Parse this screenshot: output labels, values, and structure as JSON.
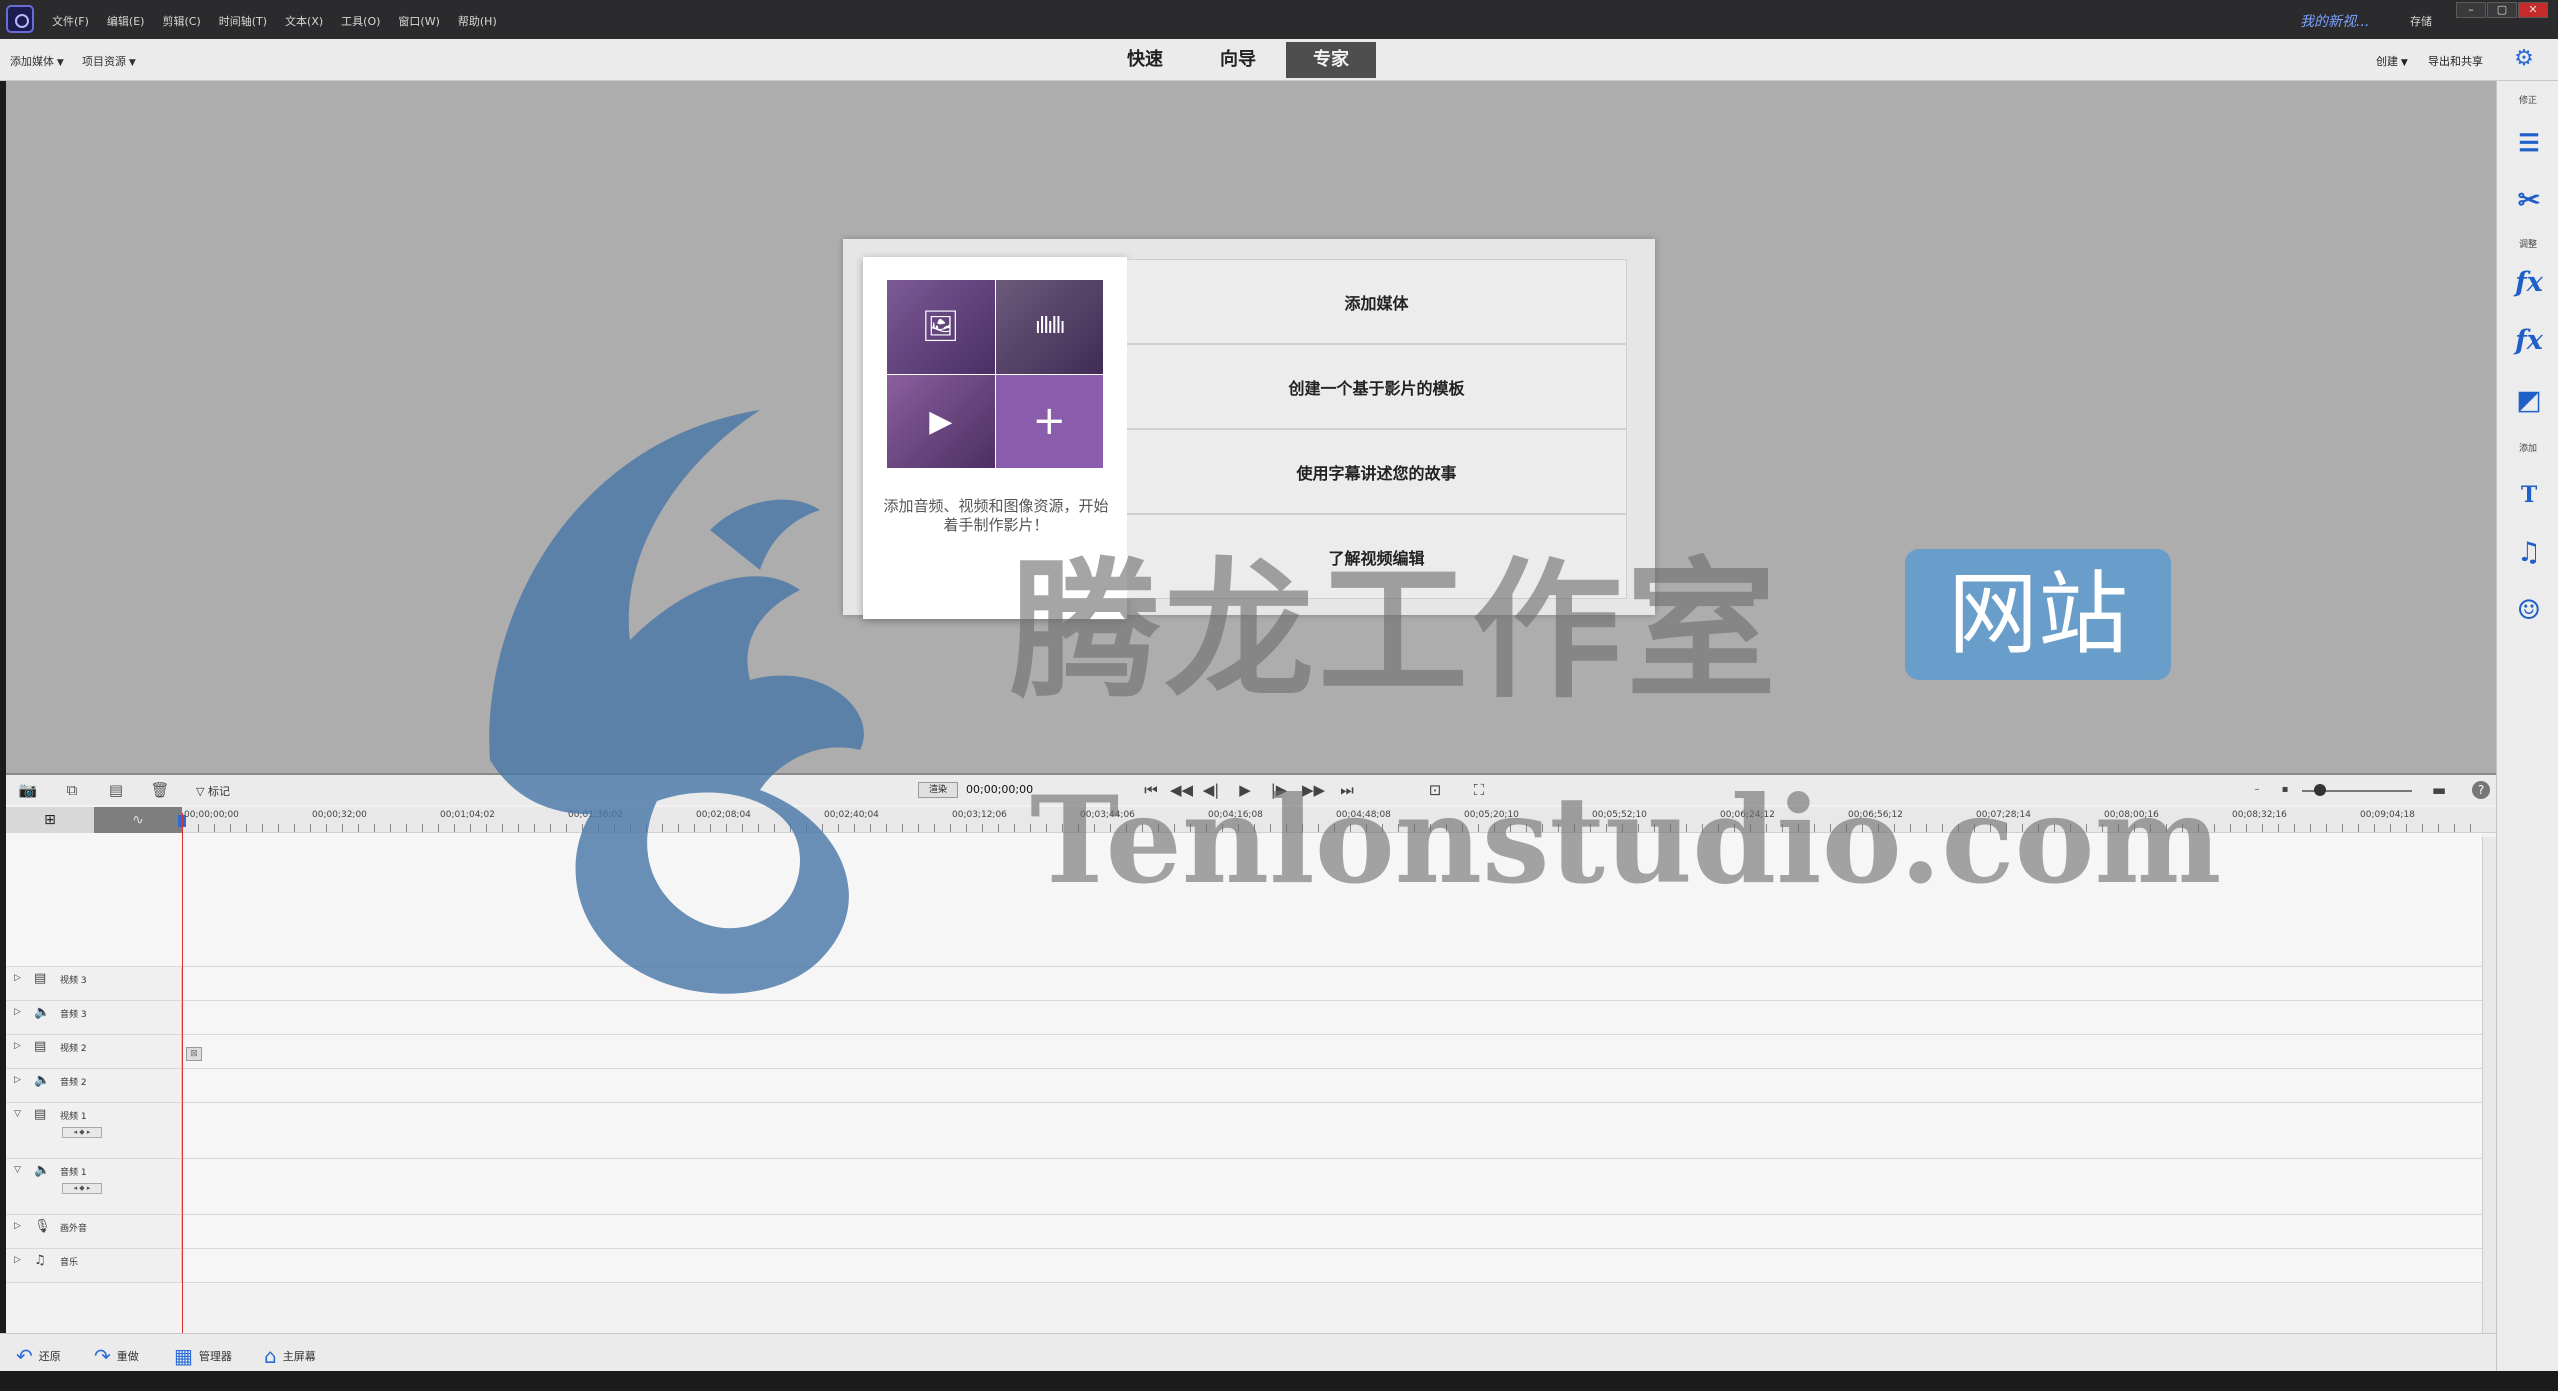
{
  "titlebar": {
    "menu": [
      "文件(F)",
      "编辑(E)",
      "剪辑(C)",
      "时间轴(T)",
      "文本(X)",
      "工具(O)",
      "窗口(W)",
      "帮助(H)"
    ],
    "project_name": "我的新视...",
    "save_label": "存储"
  },
  "topbar": {
    "add_media": "添加媒体",
    "project_assets": "项目资源",
    "modes": [
      "快速",
      "向导",
      "专家"
    ],
    "active_mode": "专家",
    "create": "创建",
    "export_share": "导出和共享"
  },
  "right_panel": {
    "adjust_label": "修正",
    "effects_label": "调整",
    "add_label": "添加",
    "icons": [
      "adjust-icon",
      "tools-icon",
      "fx-edit-icon",
      "fx-icon",
      "transitions-icon",
      "title-icon",
      "music-icon",
      "graphics-icon"
    ]
  },
  "welcome": {
    "description": "添加音频、视频和图像资源，开始着手制作影片！",
    "options": [
      "添加媒体",
      "创建一个基于影片的模板",
      "使用字幕讲述您的故事",
      "了解视频编辑"
    ]
  },
  "timeline": {
    "mark_label": "标记",
    "timecode_label": "渲染",
    "current_timecode": "00;00;00;00",
    "ruler_labels": [
      "00;00;00;00",
      "00;00;32;00",
      "00;01;04;02",
      "00;01;36;02",
      "00;02;08;04",
      "00;02;40;04",
      "00;03;12;06",
      "00;03;44;06",
      "00;04;16;08",
      "00;04;48;08",
      "00;05;20;10",
      "00;05;52;10",
      "00;06;24;12",
      "00;06;56;12",
      "00;07;28;14",
      "00;08;00;16",
      "00;08;32;16",
      "00;09;04;18"
    ],
    "tracks": [
      {
        "name": "视频 3",
        "type": "video"
      },
      {
        "name": "音频 3",
        "type": "audio"
      },
      {
        "name": "视频 2",
        "type": "video"
      },
      {
        "name": "音频 2",
        "type": "audio"
      },
      {
        "name": "视频 1",
        "type": "video"
      },
      {
        "name": "音频 1",
        "type": "audio"
      },
      {
        "name": "画外音",
        "type": "narration"
      },
      {
        "name": "音乐",
        "type": "music"
      }
    ]
  },
  "bottombar": {
    "undo": "还原",
    "redo": "重做",
    "organizer": "管理器",
    "home": "主屏幕"
  },
  "watermark": {
    "cn": "腾龙工作室",
    "badge": "网站",
    "en": "Tenlonstudio.com"
  },
  "colors": {
    "accent": "#2a6bd6",
    "playhead": "#d93030",
    "welcome_tile": "#8a5cac",
    "watermark_badge": "#5c9bcd"
  }
}
